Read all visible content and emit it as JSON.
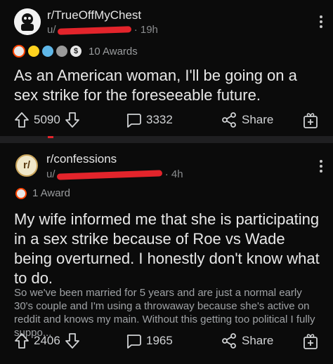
{
  "post1": {
    "subreddit": "r/TrueOffMyChest",
    "user_prefix": "u/",
    "age": "· 19h",
    "awards_count_label": "10 Awards",
    "title": "As an American woman, I'll be going on a sex strike for the foreseeable future.",
    "upvotes": "5090",
    "comments": "3332",
    "share_label": "Share"
  },
  "post2": {
    "avatar_text": "r/",
    "subreddit": "r/confessions",
    "user_prefix": "u/",
    "age": "· 4h",
    "awards_count_label": "1 Award",
    "title": "My wife informed me that she is participating in a sex strike because of Roe vs Wade being overturned. I honestly don't know what to do.",
    "body": "So we've been married for 5 years and are just a normal early 30's couple and I'm using a throwaway because she's active on reddit and knows my main. Without this getting too political I fully suppo...",
    "upvotes": "2406",
    "comments": "1965",
    "share_label": "Share"
  },
  "icons": {
    "upvote": "upvote-arrow-icon",
    "downvote": "downvote-arrow-icon",
    "comment": "comment-bubble-icon",
    "share": "share-icon",
    "award": "add-award-icon",
    "more": "more-vertical-icon"
  },
  "colors": {
    "background": "#0b0b0b",
    "separator": "#1f1f21",
    "redaction": "#e3242b",
    "text": "#e8e8e8",
    "muted": "#8a8c8e"
  }
}
